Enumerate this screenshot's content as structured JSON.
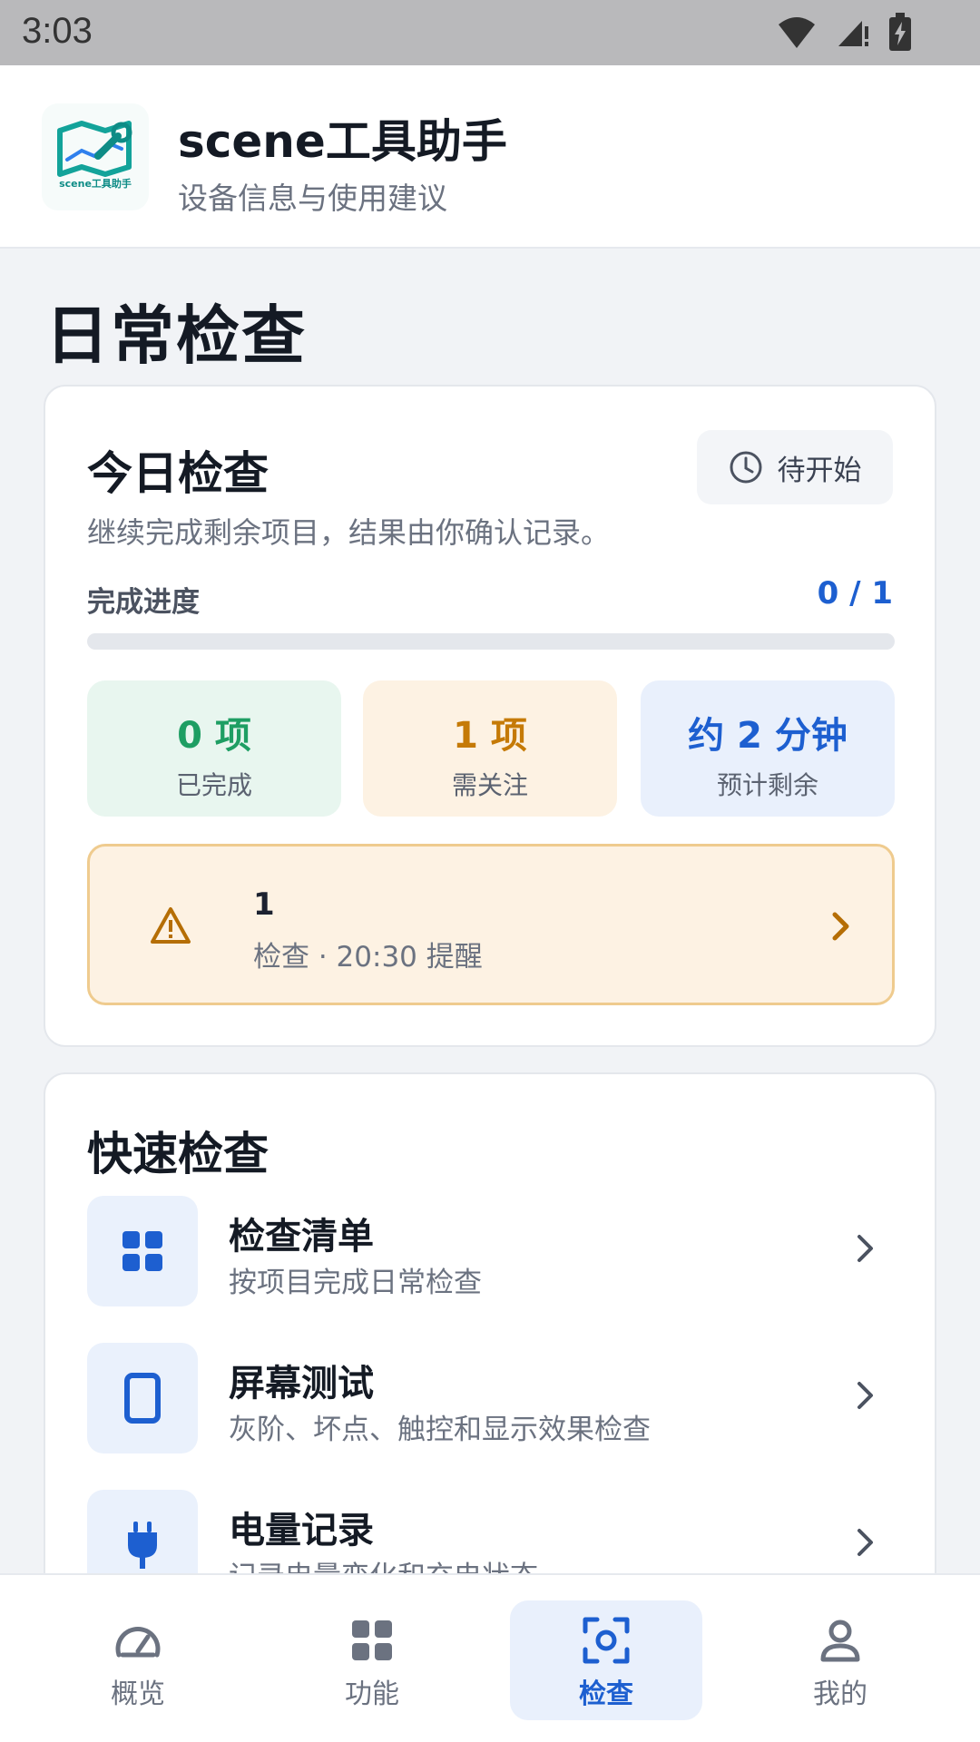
{
  "status_bar": {
    "time": "3:03"
  },
  "app": {
    "title": "scene工具助手",
    "subtitle": "设备信息与使用建议",
    "logo_caption": "scene工具助手"
  },
  "page": {
    "title": "日常检查"
  },
  "today": {
    "title": "今日检查",
    "status_label": "待开始",
    "description": "继续完成剩余项目，结果由你确认记录。",
    "progress_label": "完成进度",
    "progress_text": "0 / 1",
    "progress_fraction": 0,
    "stats": [
      {
        "value": "0 项",
        "label": "已完成"
      },
      {
        "value": "1 项",
        "label": "需关注"
      },
      {
        "value": "约 2 分钟",
        "label": "预计剩余"
      }
    ],
    "reminder": {
      "title": "1",
      "subtitle": "检查 · 20:30 提醒"
    }
  },
  "quick": {
    "title": "快速检查",
    "items": [
      {
        "label": "检查清单",
        "sub": "按项目完成日常检查",
        "icon": "grid-icon"
      },
      {
        "label": "屏幕测试",
        "sub": "灰阶、坏点、触控和显示效果检查",
        "icon": "phone-icon"
      },
      {
        "label": "电量记录",
        "sub": "记录电量变化和充电状态",
        "icon": "plug-icon"
      }
    ]
  },
  "nav": [
    {
      "label": "概览",
      "icon": "gauge-icon",
      "active": false
    },
    {
      "label": "功能",
      "icon": "grid-icon",
      "active": false
    },
    {
      "label": "检查",
      "icon": "scan-icon",
      "active": true
    },
    {
      "label": "我的",
      "icon": "person-icon",
      "active": false
    }
  ],
  "colors": {
    "accent": "#1D5FD0",
    "success": "#1E9E63",
    "warning": "#C57A06",
    "warning_bg": "#FDF2E3",
    "brand_teal": "#0E8C86"
  }
}
